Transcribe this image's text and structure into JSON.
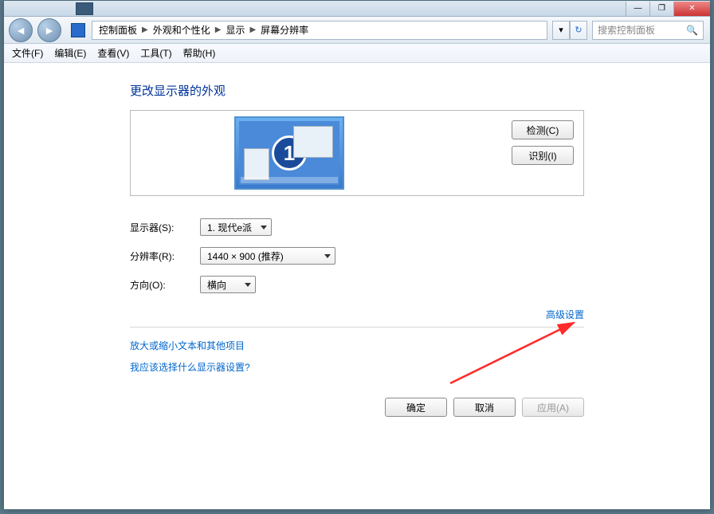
{
  "titlebar": {
    "min": "—",
    "max": "❐",
    "close": "✕"
  },
  "breadcrumb": {
    "items": [
      "控制面板",
      "外观和个性化",
      "显示",
      "屏幕分辨率"
    ]
  },
  "nav": {
    "back": "◄",
    "forward": "►",
    "dropdown": "▾",
    "refresh": "↻"
  },
  "search": {
    "placeholder": "搜索控制面板",
    "icon": "🔍"
  },
  "menubar": [
    "文件(F)",
    "编辑(E)",
    "查看(V)",
    "工具(T)",
    "帮助(H)"
  ],
  "page": {
    "title": "更改显示器的外观",
    "monitor_number": "1",
    "detect_btn": "检测(C)",
    "identify_btn": "识别(I)"
  },
  "form": {
    "display_label": "显示器(S):",
    "display_value": "1. 现代e派",
    "resolution_label": "分辨率(R):",
    "resolution_value": "1440 × 900 (推荐)",
    "orientation_label": "方向(O):",
    "orientation_value": "横向"
  },
  "links": {
    "advanced": "高级设置",
    "zoom": "放大或缩小文本和其他项目",
    "which": "我应该选择什么显示器设置?"
  },
  "actions": {
    "ok": "确定",
    "cancel": "取消",
    "apply": "应用(A)"
  }
}
